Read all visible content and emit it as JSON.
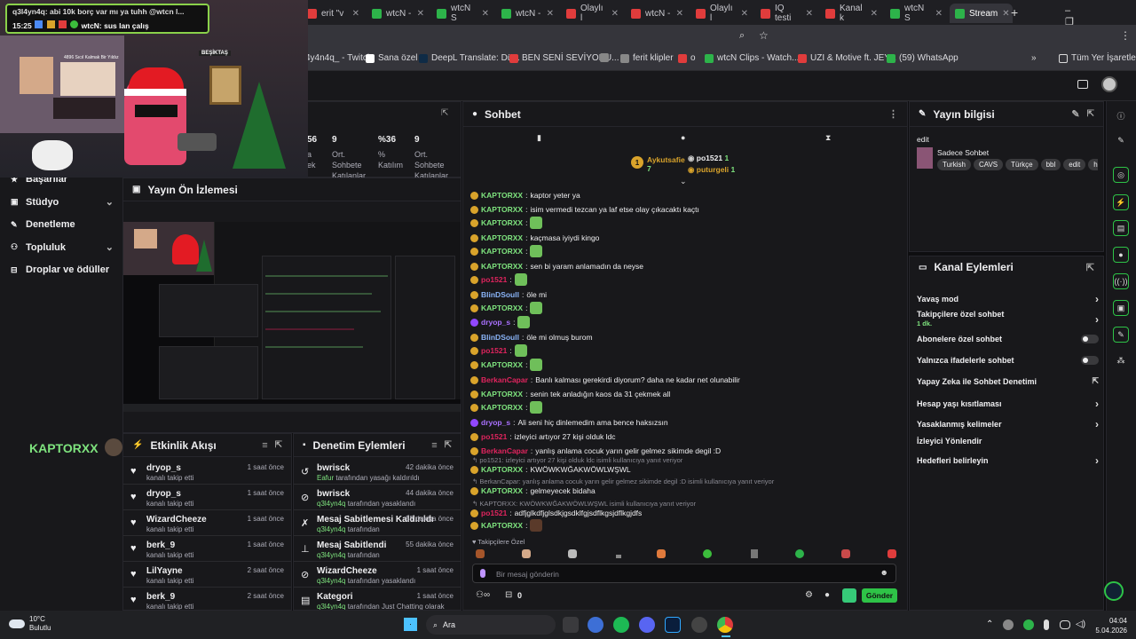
{
  "browser": {
    "tabs": [
      {
        "label": "erit \"v",
        "color": "#e03c3c"
      },
      {
        "label": "wtcN -",
        "color": "#2db34a"
      },
      {
        "label": "wtcN S",
        "color": "#2db34a"
      },
      {
        "label": "wtcN -",
        "color": "#2db34a"
      },
      {
        "label": "Olaylı l",
        "color": "#e03c3c"
      },
      {
        "label": "wtcN -",
        "color": "#e03c3c"
      },
      {
        "label": "Olaylı l",
        "color": "#e03c3c"
      },
      {
        "label": "IQ testi",
        "color": "#e03c3c"
      },
      {
        "label": "Kanal k",
        "color": "#e03c3c"
      },
      {
        "label": "wtcN S",
        "color": "#2db34a"
      },
      {
        "label": "Stream",
        "color": "#2db34a"
      }
    ],
    "bookmarks": [
      {
        "label": "4y4n4q_ - Twitch",
        "color": "#9147ff"
      },
      {
        "label": "Sana özel",
        "color": "#ffffff"
      },
      {
        "label": "DeepL Translate: Dü...",
        "color": "#0f2b46"
      },
      {
        "label": "BEN SENİ SEVİYORU...",
        "color": "#e03c3c"
      },
      {
        "label": "",
        "color": "#888888"
      },
      {
        "label": "ferit klipler",
        "color": "#888888"
      },
      {
        "label": "o",
        "color": "#e03c3c"
      },
      {
        "label": "wtcN Clips - Watch...",
        "color": "#2db34a"
      },
      {
        "label": "UZI & Motive ft. JEY...",
        "color": "#e03c3c"
      },
      {
        "label": "(59) WhatsApp",
        "color": "#2db34a"
      }
    ],
    "all_bookmarks": "Tüm Yer İşaretleri"
  },
  "overlay": {
    "chat_line1": "q3l4yn4q: abi 10k borç var mı ya tuhh @wtcn l...",
    "chat_time": "15:25",
    "chat_line2": "wtcN: sus lan çalış",
    "caption_left": "4896 Sıcıl Kalmak Bir Yıldız",
    "caption_right": "BEŞİKTAŞ"
  },
  "leftnav": {
    "items": [
      {
        "label": "Başarılar",
        "chevron": false
      },
      {
        "label": "Stüdyo",
        "chevron": true
      },
      {
        "label": "Denetleme",
        "chevron": false
      },
      {
        "label": "Topluluk",
        "chevron": true
      },
      {
        "label": "Droplar ve ödüller",
        "chevron": false
      }
    ]
  },
  "stats": [
    {
      "value": "56",
      "label": "a\nek"
    },
    {
      "value": "9",
      "label": "Ort.\nSohbete\nKatılanlar"
    },
    {
      "value": "%36",
      "label": "%\nKatılım"
    },
    {
      "value": "9",
      "label": "Ort.\nSohbete\nKatılanlar"
    }
  ],
  "preview": {
    "title": "Yayın Ön İzlemesi",
    "channel_name": "KAPTORXX"
  },
  "activity": {
    "title": "Etkinlik Akışı",
    "rows": [
      {
        "name": "dryop_s",
        "sub": "kanalı takip etti",
        "time": "1 saat önce"
      },
      {
        "name": "dryop_s",
        "sub": "kanalı takip etti",
        "time": "1 saat önce"
      },
      {
        "name": "WizardCheeze",
        "sub": "kanalı takip etti",
        "time": "1 saat önce"
      },
      {
        "name": "berk_9",
        "sub": "kanalı takip etti",
        "time": "1 saat önce"
      },
      {
        "name": "LilYayne",
        "sub": "kanalı takip etti",
        "time": "2 saat önce"
      },
      {
        "name": "berk_9",
        "sub": "kanalı takip etti",
        "time": "2 saat önce"
      }
    ]
  },
  "modactions": {
    "title": "Denetim Eylemleri",
    "rows": [
      {
        "name": "bwrisck",
        "user": "Eafur",
        "sub": " tarafından yasağı kaldırıldı",
        "time": "42 dakika önce"
      },
      {
        "name": "bwrisck",
        "user": "q3l4yn4q",
        "sub": " tarafından yasaklandı",
        "time": "44 dakika önce"
      },
      {
        "name": "Mesaj Sabitlemesi Kaldırıldı",
        "user": "q3l4yn4q",
        "sub": " tarafından",
        "time": "55 dakika önce"
      },
      {
        "name": "Mesaj Sabitlendi",
        "user": "q3l4yn4q",
        "sub": " tarafından",
        "time": "55 dakika önce"
      },
      {
        "name": "WizardCheeze",
        "user": "q3l4yn4q",
        "sub": " tarafından yasaklandı",
        "time": "1 saat önce"
      },
      {
        "name": "Kategori",
        "user": "q3l4yn4q",
        "sub": " tarafından Just Chatting olarak",
        "time": "1 saat önce"
      }
    ]
  },
  "chat": {
    "title": "Sohbet",
    "hype_users": [
      {
        "name": "Aykutsafie",
        "count": "7"
      },
      {
        "name": "po1521",
        "count": "1"
      },
      {
        "name": "puturgeli",
        "count": "1"
      }
    ],
    "messages": [
      {
        "user": "KAPTORXX",
        "color": "#7ee37e",
        "text": "kaptor yeter ya",
        "emote": false
      },
      {
        "user": "KAPTORXX",
        "color": "#7ee37e",
        "text": "isim vermedi tezcan ya laf etse olay çıkacaktı kaçtı",
        "emote": false
      },
      {
        "user": "KAPTORXX",
        "color": "#7ee37e",
        "text": "",
        "emote": true
      },
      {
        "user": "KAPTORXX",
        "color": "#7ee37e",
        "text": "kaçmasa iyiydi kingo",
        "emote": false
      },
      {
        "user": "KAPTORXX",
        "color": "#7ee37e",
        "text": "",
        "emote": true
      },
      {
        "user": "KAPTORXX",
        "color": "#7ee37e",
        "text": "sen bi yaram anlamadın da neyse",
        "emote": false
      },
      {
        "user": "po1521",
        "color": "#e0245e",
        "text": "",
        "emote": true
      },
      {
        "user": "BlinDSoull",
        "color": "#8ab4f8",
        "text": "öle mi",
        "emote": false
      },
      {
        "user": "KAPTORXX",
        "color": "#7ee37e",
        "text": "",
        "emote": true
      },
      {
        "user": "dryop_s",
        "color": "#a970ff",
        "text": "",
        "emote": true
      },
      {
        "user": "BlinDSoull",
        "color": "#8ab4f8",
        "text": "öle mi olmuş burom",
        "emote": false
      },
      {
        "user": "po1521",
        "color": "#e0245e",
        "text": "",
        "emote": true
      },
      {
        "user": "KAPTORXX",
        "color": "#7ee37e",
        "text": "",
        "emote": true
      },
      {
        "user": "BerkanCapar",
        "color": "#e0245e",
        "text": "Banlı kalması gerekirdi diyorum? daha ne kadar net olunabilir",
        "emote": false
      },
      {
        "user": "KAPTORXX",
        "color": "#7ee37e",
        "text": "senin tek anladığın kaos da 31 çekmek all",
        "emote": false
      },
      {
        "user": "KAPTORXX",
        "color": "#7ee37e",
        "text": "",
        "emote": true
      },
      {
        "user": "dryop_s",
        "color": "#a970ff",
        "text": "Ali seni hiç dinlemedim ama bence haksızsın",
        "emote": false
      },
      {
        "user": "po1521",
        "color": "#e0245e",
        "text": "izleyici artıyor 27 kişi olduk ldc",
        "emote": false
      },
      {
        "user": "BerkanCapar",
        "color": "#e0245e",
        "text": "yanlış anlama cocuk yarın gelir gelmez sikimde degil :D",
        "emote": false
      }
    ],
    "replies": [
      {
        "reply": "po1521: izleyici artıyor 27 kişi olduk ldc isimli kullanıcıya yanıt veriyor",
        "user": "KAPTORXX",
        "color": "#7ee37e",
        "text": "KWÖWKWĞAKWÖWLWŞWL"
      },
      {
        "reply": "BerkanCapar: yanlış anlama cocuk yarın gelir gelmez sikimde degil :D isimli kullanıcıya yanıt veriyor",
        "user": "KAPTORXX",
        "color": "#7ee37e",
        "text": "gelmeyecek bidaha"
      },
      {
        "reply": "KAPTORXX: KWÖWKWĞAKWÖWLWŞWL isimli kullanıcıya yanıt veriyor",
        "user": "po1521",
        "color": "#e0245e",
        "text": "adfjglkdfjglsdkjgsdklfgjsdflkgsjdflkgjdfs"
      }
    ],
    "last": {
      "user": "KAPTORXX",
      "color": "#7ee37e"
    },
    "followers_only": "Takipçilere Özel",
    "input_placeholder": "Bir mesaj gönderin",
    "points": "0",
    "send_label": "Gönder"
  },
  "info": {
    "title": "Yayın bilgisi",
    "edit": "edit",
    "stream_title": "Sadece Sohbet",
    "tags": [
      "Turkish",
      "CAVS",
      "Türkçe",
      "bbl",
      "edit",
      "hottu"
    ]
  },
  "channel_actions": {
    "title": "Kanal Eylemleri",
    "items": [
      {
        "label": "Yavaş mod",
        "kind": "chevron",
        "sub": ""
      },
      {
        "label": "Takipçilere özel sohbet",
        "kind": "chevron",
        "sub": "1 dk."
      },
      {
        "label": "Abonelere özel sohbet",
        "kind": "toggle",
        "sub": ""
      },
      {
        "label": "Yalnızca ifadelerle sohbet",
        "kind": "toggle",
        "sub": ""
      },
      {
        "label": "Yapay Zeka ile Sohbet Denetimi",
        "kind": "external",
        "sub": ""
      },
      {
        "label": "Hesap yaşı kısıtlaması",
        "kind": "chevron",
        "sub": ""
      },
      {
        "label": "Yasaklanmış kelimeler",
        "kind": "chevron",
        "sub": ""
      },
      {
        "label": "İzleyici Yönlendir",
        "kind": "none",
        "sub": ""
      },
      {
        "label": "Hedefleri belirleyin",
        "kind": "chevron",
        "sub": ""
      }
    ]
  },
  "taskbar": {
    "weather_temp": "10°C",
    "weather_desc": "Bulutlu",
    "search": "Ara",
    "time": "04:04",
    "date": "5.04.2026"
  }
}
